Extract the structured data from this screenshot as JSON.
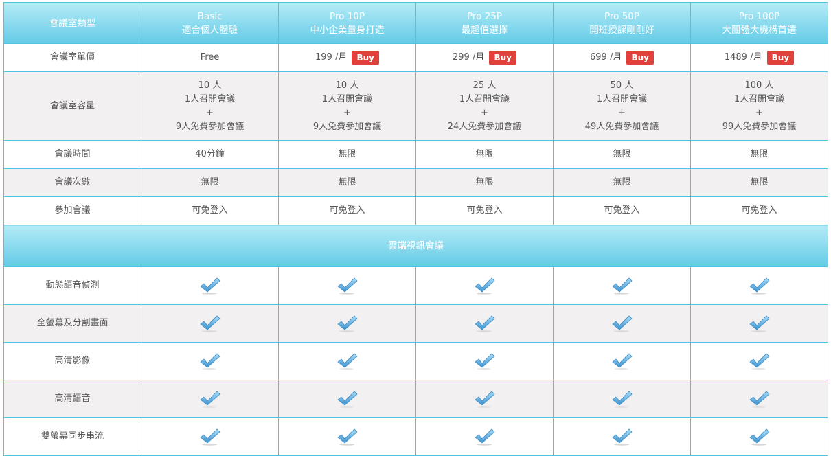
{
  "header": {
    "label": "會議室類型",
    "plans": [
      {
        "name": "Basic",
        "subtitle": "適合個人體驗"
      },
      {
        "name": "Pro 10P",
        "subtitle": "中小企業量身打造"
      },
      {
        "name": "Pro 25P",
        "subtitle": "最超值選擇"
      },
      {
        "name": "Pro 50P",
        "subtitle": "開班授課剛剛好"
      },
      {
        "name": "Pro 100P",
        "subtitle": "大團體大機構首選"
      }
    ]
  },
  "price_row": {
    "label": "會議室單價",
    "basic_value": "Free",
    "per_month": "/月",
    "buy_label": "Buy",
    "paid": [
      "199",
      "299",
      "699",
      "1489"
    ]
  },
  "capacity_row": {
    "label": "會議室容量",
    "plus": "+",
    "host_line": "1人召開會議",
    "cells": [
      {
        "people": "10 人",
        "guests": "9人免費參加會議"
      },
      {
        "people": "10 人",
        "guests": "9人免費參加會議"
      },
      {
        "people": "25 人",
        "guests": "24人免費參加會議"
      },
      {
        "people": "50 人",
        "guests": "49人免費參加會議"
      },
      {
        "people": "100 人",
        "guests": "99人免費參加會議"
      }
    ]
  },
  "time_row": {
    "label": "會議時間",
    "values": [
      "40分鐘",
      "無限",
      "無限",
      "無限",
      "無限"
    ]
  },
  "count_row": {
    "label": "會議次數",
    "values": [
      "無限",
      "無限",
      "無限",
      "無限",
      "無限"
    ]
  },
  "join_row": {
    "label": "參加會議",
    "values": [
      "可免登入",
      "可免登入",
      "可免登入",
      "可免登入",
      "可免登入"
    ]
  },
  "section": {
    "title": "雲端視訊會議"
  },
  "features": [
    {
      "label": "動態語音偵測"
    },
    {
      "label": "全螢幕及分割畫面"
    },
    {
      "label": "高清影像"
    },
    {
      "label": "高清語音"
    },
    {
      "label": "雙螢幕同步串流"
    }
  ],
  "colors": {
    "header_gradient_top": "#b4ebf6",
    "header_gradient_bottom": "#64cbe6",
    "border": "#4fc3e0",
    "buy": "#e0413a",
    "check": "#5aaedf"
  },
  "icons": {
    "feature_included": "check-icon"
  }
}
